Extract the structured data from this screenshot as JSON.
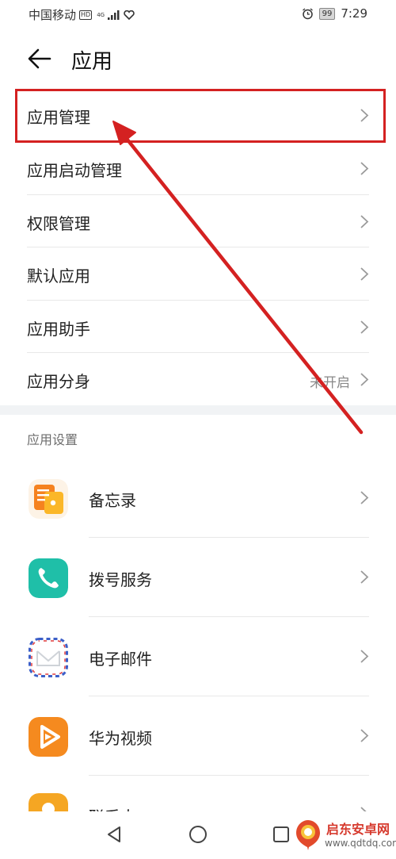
{
  "status_bar": {
    "carrier": "中国移动",
    "hd": "HD",
    "network": "4G",
    "battery": "99",
    "time": "7:29"
  },
  "header": {
    "title": "应用"
  },
  "menu": [
    {
      "label": "应用管理",
      "value": ""
    },
    {
      "label": "应用启动管理",
      "value": ""
    },
    {
      "label": "权限管理",
      "value": ""
    },
    {
      "label": "默认应用",
      "value": ""
    },
    {
      "label": "应用助手",
      "value": ""
    },
    {
      "label": "应用分身",
      "value": "未开启"
    }
  ],
  "section": {
    "title": "应用设置"
  },
  "apps": [
    {
      "name": "备忘录",
      "icon": "memo-icon",
      "color": "#f39a2e"
    },
    {
      "name": "拨号服务",
      "icon": "phone-icon",
      "color": "#1fbfa8"
    },
    {
      "name": "电子邮件",
      "icon": "mail-icon",
      "color": "#ffffff"
    },
    {
      "name": "华为视频",
      "icon": "video-icon",
      "color": "#f58a1f"
    },
    {
      "name": "联系人",
      "icon": "contacts-icon",
      "color": "#f5a623"
    }
  ],
  "annotation": {
    "highlight_color": "#d42121"
  },
  "watermark": {
    "title": "启东安卓网",
    "url": "www.qdtdq.com"
  }
}
